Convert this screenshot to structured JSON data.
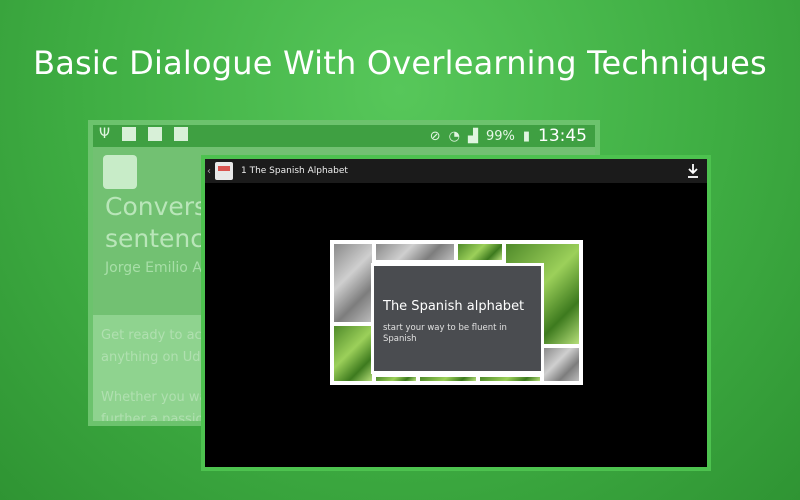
{
  "headline": "Basic Dialogue With Overlearning Techniques",
  "back_screen": {
    "status_bar": {
      "battery": "99%",
      "clock": "13:45"
    },
    "course": {
      "title_line1": "Conversa",
      "title_line2": "sentence",
      "author": "Jorge Emilio A",
      "desc_para1_line1": "Get ready to acce",
      "desc_para1_line2": "anything on Uder",
      "desc_para2_line1": "Whether you wan",
      "desc_para2_line2": "further a passion"
    }
  },
  "player": {
    "title": "1  The Spanish Alphabet",
    "video": {
      "card_title": "The Spanish alphabet",
      "card_subtitle": "start your way to be fluent in Spanish"
    }
  },
  "icons": {
    "back": "chevron-left-icon",
    "download": "download-icon",
    "app": "app-icon"
  }
}
